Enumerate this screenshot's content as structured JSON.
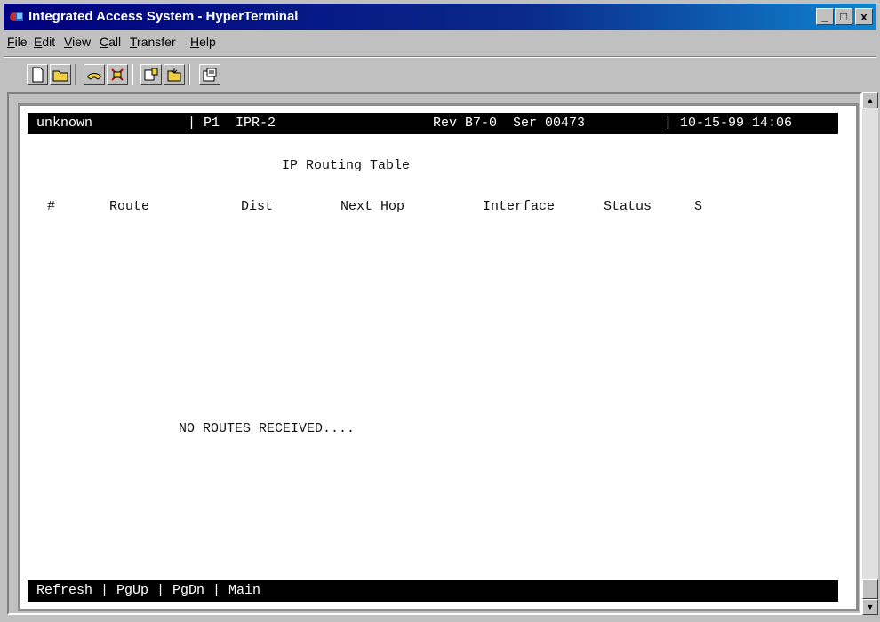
{
  "window": {
    "title": "Integrated Access System - HyperTerminal",
    "controls": {
      "minimize": "_",
      "maximize": "□",
      "close": "x"
    }
  },
  "menu": {
    "items": [
      "File",
      "Edit",
      "View",
      "Call",
      "Transfer",
      "Help"
    ]
  },
  "toolbar": {
    "buttons": [
      "new-icon",
      "open-icon",
      "connect-icon",
      "disconnect-icon",
      "send-icon",
      "receive-icon",
      "properties-icon"
    ]
  },
  "terminal": {
    "top_bar": {
      "host": "unknown",
      "port": "| P1  IPR-2",
      "revision": "Rev B7-0  Ser 00473",
      "datetime": "| 10-15-99 14:06"
    },
    "title": "IP Routing Table",
    "columns": [
      "#",
      "Route",
      "Dist",
      "Next Hop",
      "Interface",
      "Status",
      "S"
    ],
    "message": "NO ROUTES RECEIVED....",
    "bottom_bar": "Refresh | PgUp | PgDn | Main"
  },
  "colors": {
    "titlebar": "#000080",
    "terminal_bg": "#ffffff",
    "status_bar": "#000000"
  }
}
